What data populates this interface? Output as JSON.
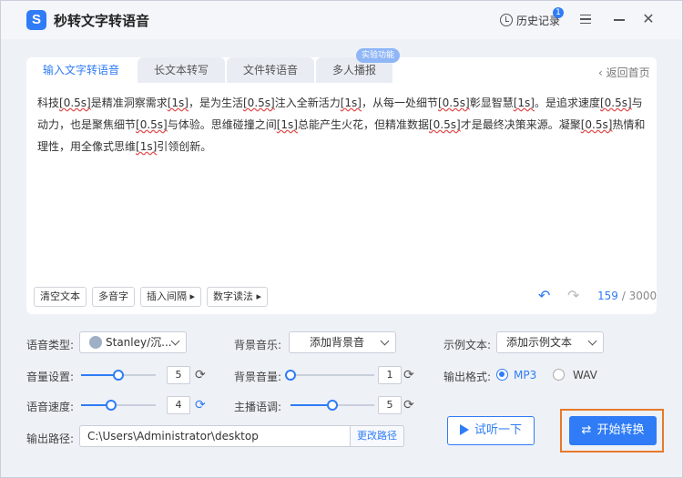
{
  "app": {
    "title": "秒转文字转语音",
    "logo": "S"
  },
  "header": {
    "history_label": "历史记录",
    "history_count": "1"
  },
  "tabs": [
    {
      "label": "输入文字转语音",
      "active": true
    },
    {
      "label": "长文本转写",
      "active": false
    },
    {
      "label": "文件转语音",
      "active": false
    },
    {
      "label": "多人播报",
      "active": false
    }
  ],
  "tab_badge": "实验功能",
  "back_label": "返回首页",
  "editor": {
    "segments": [
      {
        "t": "科技"
      },
      {
        "t": "[0.5s]",
        "tag": true
      },
      {
        "t": "是精准洞察需求"
      },
      {
        "t": "[1s]",
        "tag": true
      },
      {
        "t": "，是为生活"
      },
      {
        "t": "[0.5s]",
        "tag": true
      },
      {
        "t": "注入全新活力"
      },
      {
        "t": "[1s]",
        "tag": true
      },
      {
        "t": "，从每一处细节"
      },
      {
        "t": "[0.5s]",
        "tag": true
      },
      {
        "t": "彰显智慧"
      },
      {
        "t": "[1s]",
        "tag": true
      },
      {
        "t": "。是追求速度"
      },
      {
        "t": "[0.5s]",
        "tag": true
      },
      {
        "t": "与动力，也是聚焦细节"
      },
      {
        "t": "[0.5s]",
        "tag": true
      },
      {
        "t": "与体验。思维碰撞之间"
      },
      {
        "t": "[1s]",
        "tag": true
      },
      {
        "t": "总能产生火花，但精准数据"
      },
      {
        "t": "[0.5s]",
        "tag": true
      },
      {
        "t": "才是最终决策来源。凝聚"
      },
      {
        "t": "[0.5s]",
        "tag": true
      },
      {
        "t": "热情和理性，用全像式思维"
      },
      {
        "t": "[1s]",
        "tag": true
      },
      {
        "t": "引领创新。"
      }
    ]
  },
  "toolbar": {
    "clear": "清空文本",
    "polyphone": "多音字",
    "insert_pause": "插入间隔 ▸",
    "number_read": "数字读法 ▸"
  },
  "char_count": {
    "current": "159",
    "sep": " / ",
    "max": "3000"
  },
  "settings": {
    "voice_label": "语音类型:",
    "voice_value": "Stanley/沉...",
    "bgm_label": "背景音乐:",
    "bgm_value": "添加背景音",
    "sample_label": "示例文本:",
    "sample_value": "添加示例文本",
    "volume_label": "音量设置:",
    "volume_value": "5",
    "volume_level": 0.5,
    "bgvol_label": "背景音量:",
    "bgvol_value": "1",
    "bgvol_level": 0.0,
    "speed_label": "语音速度:",
    "speed_value": "4",
    "speed_level": 0.4,
    "pitch_label": "主播语调:",
    "pitch_value": "5",
    "pitch_level": 0.5,
    "format_label": "输出格式:",
    "format_mp3": "MP3",
    "format_wav": "WAV",
    "format_selected": "MP3",
    "path_label": "输出路径:",
    "path_value": "C:\\Users\\Administrator\\desktop",
    "change_path": "更改路径"
  },
  "actions": {
    "listen": "试听一下",
    "start": "开始转换"
  },
  "colors": {
    "accent": "#2f7cf6",
    "highlight_frame": "#e8792b"
  }
}
